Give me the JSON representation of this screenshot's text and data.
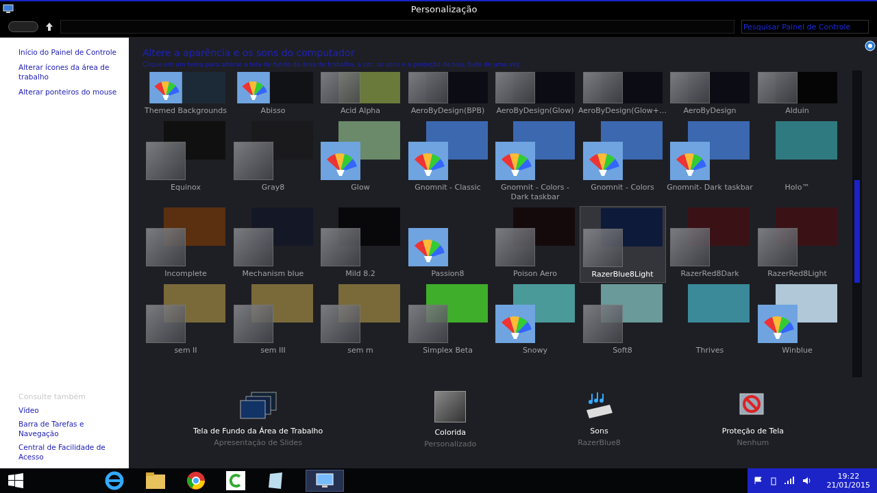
{
  "window": {
    "title": "Personalização"
  },
  "address_bar": {
    "search_placeholder": "Pesquisar Painel de Controle"
  },
  "sidebar": {
    "links": [
      "Início do Painel de Controle",
      "Alterar ícones da área de trabalho",
      "Alterar ponteiros do mouse"
    ],
    "see_also_heading": "Consulte também",
    "see_also": [
      "Vídeo",
      "Barra de Tarefas e Navegação",
      "Central de Facilidade de Acesso"
    ]
  },
  "main": {
    "heading": "Altere a aparência e os sons do computador",
    "description": "Clique em um tema para alterar a tela de fundo da área de trabalho, a cor, os sons e a proteção de tela, tudo de uma vez."
  },
  "themes": [
    {
      "name": "Themed Backgrounds",
      "kind": "palette",
      "color": "#1b2a36",
      "selected": false
    },
    {
      "name": "Abisso",
      "kind": "palette",
      "color": "#111216",
      "selected": false
    },
    {
      "name": "Acid Alpha",
      "kind": "glass",
      "color": "#6a7a3a",
      "selected": false
    },
    {
      "name": "AeroByDesign(BPB)",
      "kind": "glass",
      "color": "#0c0c14",
      "selected": false
    },
    {
      "name": "AeroByDesign(Glow)",
      "kind": "glass",
      "color": "#0c0c14",
      "selected": false
    },
    {
      "name": "AeroByDesign(Glow+…",
      "kind": "glass",
      "color": "#0c0c14",
      "selected": false
    },
    {
      "name": "AeroByDesign",
      "kind": "glass",
      "color": "#0c0c14",
      "selected": false
    },
    {
      "name": "Alduin",
      "kind": "glass",
      "color": "#050505",
      "selected": false
    },
    {
      "name": "Equinox",
      "kind": "glass",
      "color": "#101010",
      "selected": false
    },
    {
      "name": "Gray8",
      "kind": "glass",
      "color": "#1a1a1c",
      "selected": false
    },
    {
      "name": "Glow",
      "kind": "palette",
      "color": "#6a8a6a",
      "selected": false
    },
    {
      "name": "Gnomnit - Classic",
      "kind": "palette",
      "color": "#3c68b0",
      "selected": false
    },
    {
      "name": "Gnomnit - Colors - Dark taskbar",
      "kind": "palette",
      "color": "#3c68b0",
      "selected": false
    },
    {
      "name": "Gnomnit - Colors",
      "kind": "palette",
      "color": "#3c68b0",
      "selected": false
    },
    {
      "name": "Gnomnit- Dark taskbar",
      "kind": "palette",
      "color": "#3c68b0",
      "selected": false
    },
    {
      "name": "Holo™",
      "kind": "none",
      "color": "#2f7a80",
      "selected": false
    },
    {
      "name": "Incomplete",
      "kind": "glass",
      "color": "#5a3010",
      "selected": false
    },
    {
      "name": "Mechanism blue",
      "kind": "glass",
      "color": "#141826",
      "selected": false
    },
    {
      "name": "Mild 8.2",
      "kind": "glass",
      "color": "#08080a",
      "selected": false
    },
    {
      "name": "Passion8",
      "kind": "palette",
      "color": "#1e1f24",
      "selected": false
    },
    {
      "name": "Poison Aero",
      "kind": "glass",
      "color": "#140a0c",
      "selected": false
    },
    {
      "name": "RazerBlue8Light",
      "kind": "glass",
      "color": "#0e1a3a",
      "selected": true
    },
    {
      "name": "RazerRed8Dark",
      "kind": "glass",
      "color": "#3a1216",
      "selected": false
    },
    {
      "name": "RazerRed8Light",
      "kind": "glass",
      "color": "#3a1216",
      "selected": false
    },
    {
      "name": "sem II",
      "kind": "glass",
      "color": "#7a6a3a",
      "selected": false
    },
    {
      "name": "sem III",
      "kind": "glass",
      "color": "#7a6a3a",
      "selected": false
    },
    {
      "name": "sem m",
      "kind": "glass",
      "color": "#7a6a3a",
      "selected": false
    },
    {
      "name": "Simplex Beta",
      "kind": "glass",
      "color": "#3fae2a",
      "selected": false
    },
    {
      "name": "Snowy",
      "kind": "palette",
      "color": "#4a9a9a",
      "selected": false
    },
    {
      "name": "Soft8",
      "kind": "glass",
      "color": "#6a9a9a",
      "selected": false
    },
    {
      "name": "Thrives",
      "kind": "none",
      "color": "#3a8a9a",
      "selected": false
    },
    {
      "name": "Winblue",
      "kind": "palette",
      "color": "#b0c8d8",
      "selected": false
    }
  ],
  "settings": [
    {
      "kind": "wallpaper",
      "label": "Tela de Fundo da Área de Trabalho",
      "value": "Apresentação de Slides"
    },
    {
      "kind": "color",
      "label": "Colorida",
      "value": "Personalizado"
    },
    {
      "kind": "sounds",
      "label": "Sons",
      "value": "RazerBlue8"
    },
    {
      "kind": "screensaver",
      "label": "Proteção de Tela",
      "value": "Nenhum"
    }
  ],
  "taskbar": {
    "time": "19:22",
    "date": "21/01/2015"
  }
}
